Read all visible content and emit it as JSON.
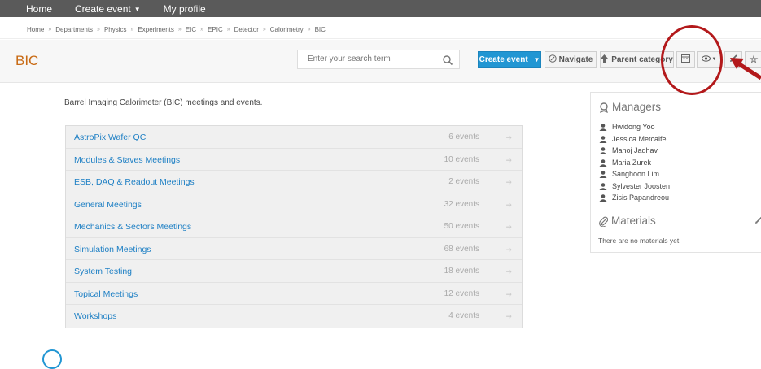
{
  "topnav": {
    "items": [
      {
        "label": "Home"
      },
      {
        "label": "Create event"
      },
      {
        "label": "My profile"
      }
    ]
  },
  "breadcrumb": [
    "Home",
    "Departments",
    "Physics",
    "Experiments",
    "EIC",
    "EPIC",
    "Detector",
    "Calorimetry",
    "BIC"
  ],
  "header": {
    "title": "BIC",
    "search_placeholder": "Enter your search term",
    "create_event": "Create event",
    "navigate": "Navigate",
    "parent_category": "Parent category"
  },
  "description": "Barrel Imaging Calorimeter (BIC) meetings and events.",
  "categories": [
    {
      "title": "AstroPix Wafer QC",
      "count": "6 events"
    },
    {
      "title": "Modules & Staves Meetings",
      "count": "10 events"
    },
    {
      "title": "ESB, DAQ & Readout Meetings",
      "count": "2 events"
    },
    {
      "title": "General Meetings",
      "count": "32 events"
    },
    {
      "title": "Mechanics & Sectors Meetings",
      "count": "50 events"
    },
    {
      "title": "Simulation Meetings",
      "count": "68 events"
    },
    {
      "title": "System Testing",
      "count": "18 events"
    },
    {
      "title": "Topical Meetings",
      "count": "12 events"
    },
    {
      "title": "Workshops",
      "count": "4 events"
    }
  ],
  "sidebar": {
    "managers_title": "Managers",
    "managers": [
      "Hwidong Yoo",
      "Jessica Metcalfe",
      "Manoj Jadhav",
      "Maria Zurek",
      "Sanghoon Lim",
      "Sylvester Joosten",
      "Zisis Papandreou"
    ],
    "materials_title": "Materials",
    "no_materials": "There are no materials yet."
  },
  "colors": {
    "accent": "#2196d3",
    "title": "#c96b15",
    "link": "#1d7fc4",
    "annotation": "#b3191b"
  }
}
